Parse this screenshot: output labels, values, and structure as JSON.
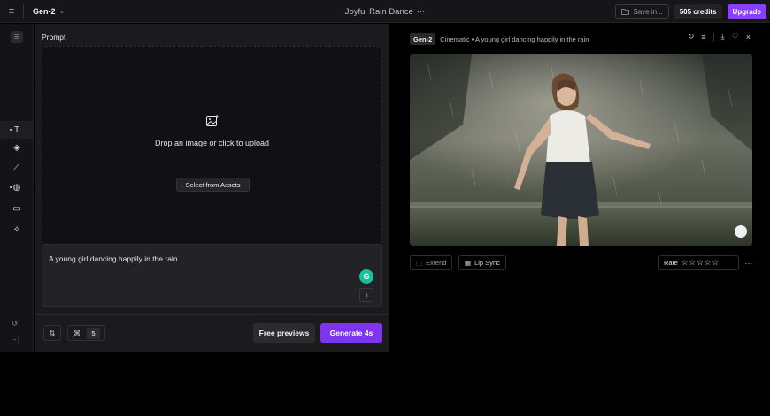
{
  "topbar": {
    "menu_icon": "≡",
    "model": "Gen-2",
    "model_chevron": "⌄",
    "project_title": "Joyful Rain Dance",
    "project_more": "···",
    "save_label": "Save in...",
    "credits": "505 credits",
    "upgrade": "Upgrade"
  },
  "rail": {
    "tools": [
      {
        "name": "text-tool",
        "glyph": "T"
      },
      {
        "name": "image-tool",
        "glyph": "◈"
      },
      {
        "name": "brush-tool",
        "glyph": "⟋"
      },
      {
        "name": "palette-tool",
        "glyph": "◍"
      },
      {
        "name": "frame-tool",
        "glyph": "▭"
      },
      {
        "name": "layers-tool",
        "glyph": "⟡"
      }
    ],
    "undo_glyph": "↺",
    "collapse_glyph": "→|"
  },
  "prompt_panel": {
    "label": "Prompt",
    "dropzone_text": "Drop an image or click to upload",
    "assets_button": "Select from Assets",
    "prompt_text": "A young girl dancing happily in the rain",
    "grammarly_glyph": "G",
    "idea_glyph": "♀",
    "settings_glyph": "⇅",
    "motion_glyph": "⌘",
    "motion_value": "5",
    "free_previews": "Free previews",
    "generate": "Generate 4s"
  },
  "output": {
    "gen_tag": "Gen-2",
    "description": "Cinematic • A young girl dancing happily in the rain",
    "actions": {
      "refresh": "↻",
      "menu": "≡",
      "download": "⤓",
      "favorite": "♡",
      "close": "×"
    },
    "extend_label": "Extend",
    "extend_glyph": "⬚",
    "lip_sync_label": "Lip Sync",
    "lip_sync_glyph": "▦",
    "rate_label": "Rate",
    "stars": "☆☆☆☆☆",
    "more": "···"
  },
  "colors": {
    "accent": "#8a3ffc",
    "panel_bg": "#1b1b1d",
    "topbar_bg": "#161618",
    "grammarly": "#15c39a"
  }
}
